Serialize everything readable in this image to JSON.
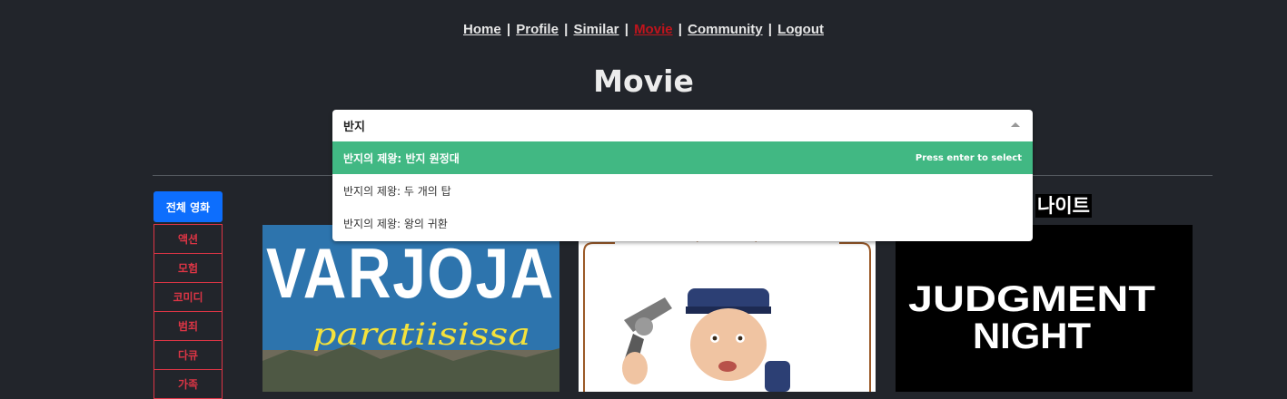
{
  "nav": {
    "items": [
      "Home",
      "Profile",
      "Similar",
      "Movie",
      "Community",
      "Logout"
    ],
    "active": "Movie",
    "active_color": "#c0141c",
    "separator": "|"
  },
  "page": {
    "title": "Movie"
  },
  "search": {
    "value": "반지",
    "options": [
      {
        "label": "반지의 제왕: 반지 원정대",
        "highlighted": true
      },
      {
        "label": "반지의 제왕: 두 개의 탑",
        "highlighted": false
      },
      {
        "label": "반지의 제왕: 왕의 귀환",
        "highlighted": false
      }
    ],
    "hint": "Press enter to select",
    "highlight_color": "#41b883"
  },
  "genres": {
    "all_label": "전체 영화",
    "items": [
      "액션",
      "모험",
      "코미디",
      "범죄",
      "다큐",
      "가족"
    ]
  },
  "movies": [
    {
      "title_visible": "",
      "poster_text_1": "VARJOJA",
      "poster_text_2": "paratiisissa"
    },
    {
      "title_visible": "",
      "poster_text_1": "",
      "poster_text_2": ""
    },
    {
      "title_visible": "나이트",
      "poster_text_1": "JUDGMENT",
      "poster_text_2": "NIGHT"
    }
  ]
}
